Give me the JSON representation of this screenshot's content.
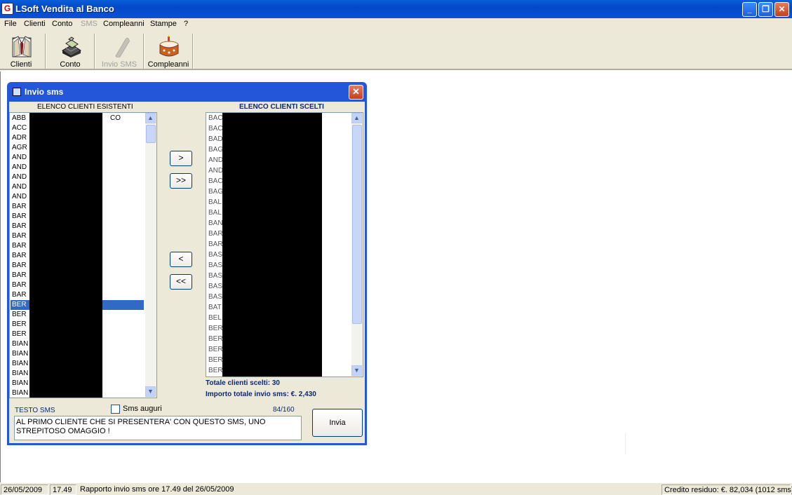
{
  "window": {
    "title": "LSoft Vendita al Banco",
    "icon_text": "G"
  },
  "menu": [
    "File",
    "Clienti",
    "Conto",
    "SMS",
    "Compleanni",
    "Stampe",
    "?"
  ],
  "toolbar": {
    "clienti": "Clienti",
    "conto": "Conto",
    "invio_sms": "Invio SMS",
    "compleanni": "Compleanni"
  },
  "dialog": {
    "title": "Invio sms",
    "close": "✕",
    "left_header": "ELENCO CLIENTI ESISTENTI",
    "right_header": "ELENCO CLIENTI SCELTI",
    "left_list": [
      "ABB",
      "ACC",
      "ADR",
      "AGR",
      "AND",
      "AND",
      "AND",
      "AND",
      "AND",
      "BAR",
      "BAR",
      "BAR",
      "BAR",
      "BAR",
      "BAR",
      "BAR",
      "BAR",
      "BAR",
      "BAR",
      "BER",
      "BER",
      "BER",
      "BER",
      "BIAN",
      "BIAN",
      "BIAN",
      "BIAN",
      "BIAN",
      "BIAN",
      "BIAN"
    ],
    "left_first_suffix": "CO",
    "right_list": [
      "BAC",
      "BAC",
      "BAD",
      "BAG",
      "AND",
      "AND",
      "BAC",
      "BAG",
      "BAL",
      "BAL",
      "BAN",
      "BAR",
      "BAR",
      "BAS",
      "BAS",
      "BAS",
      "BAS",
      "BAS",
      "BAT",
      "BEL",
      "BER",
      "BER",
      "BER",
      "BER",
      "BER"
    ],
    "btn_add": ">",
    "btn_add_all": ">>",
    "btn_remove": "<",
    "btn_remove_all": "<<",
    "totale_label": "Totale clienti scelti: 30",
    "importo_label": "Importo totale invio sms:  €. 2,430",
    "testo_sms_label": "TESTO SMS",
    "sms_auguri_label": "Sms auguri",
    "char_count": "84/160",
    "sms_text": "AL PRIMO CLIENTE CHE SI PRESENTERA' CON QUESTO SMS, UNO STREPITOSO OMAGGIO !",
    "invia": "Invia"
  },
  "status": {
    "date": "26/05/2009",
    "time": "17.49",
    "message": "Rapporto invio sms ore 17.49 del 26/05/2009",
    "credit": "Credito residuo: €. 82,034 (1012 sms)"
  }
}
